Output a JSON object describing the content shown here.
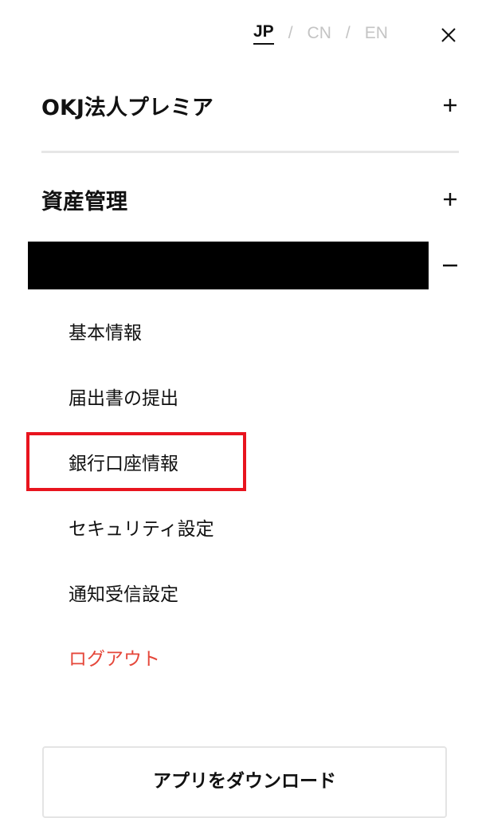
{
  "languages": {
    "jp": "JP",
    "cn": "CN",
    "en": "EN",
    "separator": "/"
  },
  "menu": {
    "premier": {
      "label": "OKJ法人プレミア",
      "toggle": "+"
    },
    "assets": {
      "label": "資産管理",
      "toggle": "+"
    },
    "account": {
      "label": "",
      "toggle": "−"
    }
  },
  "submenu": {
    "basic_info": "基本情報",
    "submit_notice": "届出書の提出",
    "bank_account": "銀行口座情報",
    "security": "セキュリティ設定",
    "notifications": "通知受信設定",
    "logout": "ログアウト"
  },
  "download_button": "アプリをダウンロード",
  "colors": {
    "accent_red": "#e5473a",
    "highlight_red": "#e8141e",
    "inactive_gray": "#c4c4c4"
  },
  "icons": {
    "close": "close-icon",
    "plus": "plus-icon",
    "minus": "minus-icon"
  }
}
